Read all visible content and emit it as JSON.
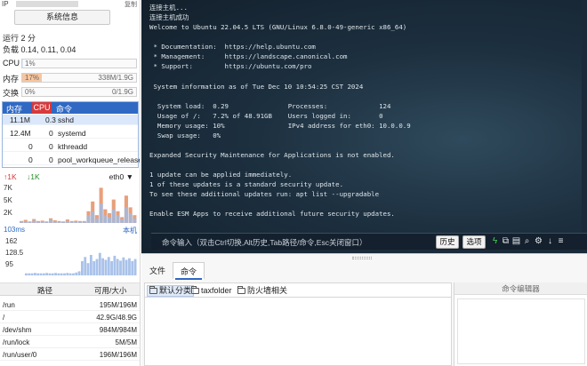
{
  "left": {
    "ip_label": "IP",
    "ip_copy": "复制",
    "sysinfo_button": "系统信息",
    "uptime": "运行 2 分",
    "load": "负载 0.14, 0.11, 0.04",
    "cpu": {
      "label": "CPU",
      "pct_text": "1%",
      "fraction": 0.01
    },
    "mem": {
      "label": "内存",
      "pct_text": "17%",
      "value": "338M/1.9G",
      "fraction": 0.17
    },
    "swap": {
      "label": "交换",
      "pct_text": "0%",
      "value": "0/1.9G",
      "fraction": 0.0
    },
    "process_table": {
      "headers": [
        "内存",
        "CPU",
        "命令"
      ],
      "rows": [
        {
          "mem": "11.1M",
          "cpu": "0.3",
          "cmd": "sshd"
        },
        {
          "mem": "12.4M",
          "cpu": "0",
          "cmd": "systemd"
        },
        {
          "mem": "0",
          "cpu": "0",
          "cmd": "kthreadd"
        },
        {
          "mem": "0",
          "cpu": "0",
          "cmd": "pool_workqueue_release"
        }
      ]
    },
    "network": {
      "up_label": "↑1K",
      "down_label": "↓1K",
      "iface": "eth0",
      "ticks": [
        "7K",
        "5K",
        "2K"
      ],
      "up_series": [
        0.05,
        0.08,
        0.04,
        0.1,
        0.05,
        0.06,
        0.04,
        0.12,
        0.07,
        0.05,
        0.04,
        0.09,
        0.05,
        0.06,
        0.05,
        0.05,
        0.3,
        0.55,
        0.2,
        0.9,
        0.35,
        0.25,
        0.6,
        0.3,
        0.15,
        0.7,
        0.4,
        0.2
      ],
      "down_series": [
        0.03,
        0.04,
        0.03,
        0.06,
        0.03,
        0.04,
        0.03,
        0.08,
        0.04,
        0.03,
        0.03,
        0.05,
        0.03,
        0.04,
        0.03,
        0.03,
        0.2,
        0.3,
        0.12,
        0.5,
        0.2,
        0.15,
        0.35,
        0.2,
        0.1,
        0.4,
        0.25,
        0.12
      ]
    },
    "latency": {
      "title": "103ms",
      "right_label": "本机",
      "ticks": [
        "162",
        "128.5",
        "95"
      ],
      "series": [
        0.05,
        0.05,
        0.05,
        0.06,
        0.05,
        0.05,
        0.05,
        0.06,
        0.05,
        0.05,
        0.06,
        0.05,
        0.05,
        0.05,
        0.06,
        0.05,
        0.05,
        0.07,
        0.1,
        0.35,
        0.45,
        0.3,
        0.5,
        0.35,
        0.4,
        0.55,
        0.42,
        0.38,
        0.45,
        0.35,
        0.48,
        0.4,
        0.36,
        0.44,
        0.38,
        0.42,
        0.35,
        0.4
      ]
    },
    "disk": {
      "headers": [
        "路径",
        "可用/大小"
      ],
      "rows": [
        {
          "path": "/run",
          "size": "195M/196M"
        },
        {
          "path": "/",
          "size": "42.9G/48.9G"
        },
        {
          "path": "/dev/shm",
          "size": "984M/984M"
        },
        {
          "path": "/run/lock",
          "size": "5M/5M"
        },
        {
          "path": "/run/user/0",
          "size": "196M/196M"
        }
      ]
    }
  },
  "terminal": {
    "lines": [
      "连接主机...",
      "连接主机成功",
      "Welcome to Ubuntu 22.04.5 LTS (GNU/Linux 6.8.0-49-generic x86_64)",
      "",
      " * Documentation:  https://help.ubuntu.com",
      " * Management:     https://landscape.canonical.com",
      " * Support:        https://ubuntu.com/pro",
      "",
      " System information as of Tue Dec 10 10:54:25 CST 2024",
      "",
      "  System load:  0.29               Processes:             124",
      "  Usage of /:   7.2% of 48.91GB    Users logged in:       0",
      "  Memory usage: 10%                IPv4 address for eth0: 10.0.0.9",
      "  Swap usage:   0%",
      "",
      "Expanded Security Maintenance for Applications is not enabled.",
      "",
      "1 update can be applied immediately.",
      "1 of these updates is a standard security update.",
      "To see these additional updates run: apt list --upgradable",
      "",
      "Enable ESM Apps to receive additional future security updates."
    ],
    "cmd_placeholder": "命令输入（双击Ctrl切换,Alt历史,Tab路径/命令,Esc关闭窗口）",
    "history_button": "历史",
    "options_button": "选项",
    "icons": [
      "lightning-icon",
      "copy-icon",
      "paste-icon",
      "search-icon",
      "settings-icon",
      "download-icon",
      "menu-icon"
    ]
  },
  "bottom": {
    "tab_files": "文件",
    "tab_commands": "命令",
    "categories": [
      "默认分类",
      "taxfolder",
      "防火墙相关"
    ],
    "editor_title": "命令编辑器"
  },
  "colors": {
    "accent": "#2f69c4",
    "cpu_header": "#d8393b",
    "mem_fill": "#f6c6a0",
    "chart_up": "#e8a07a",
    "chart_down": "#9fbbe6",
    "latency": "#a9c2ea"
  }
}
